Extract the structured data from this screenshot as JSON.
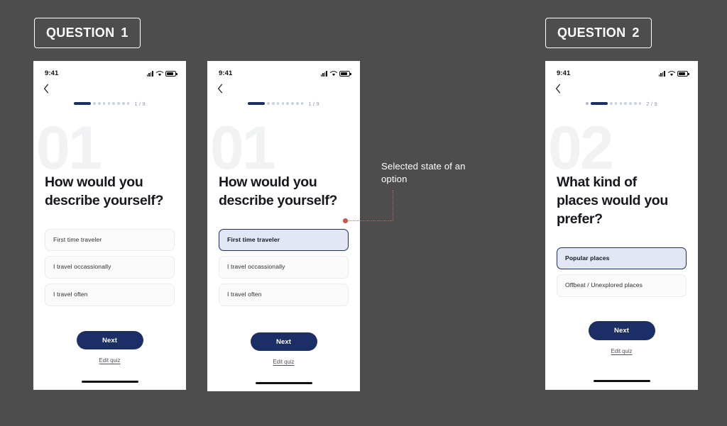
{
  "background_color": "#4d4d4d",
  "accent_color": "#1b2f66",
  "annotation_color": "#c8564a",
  "labels": [
    {
      "id": "q1",
      "text": "QUESTION",
      "number": "1"
    },
    {
      "id": "q2",
      "text": "QUESTION",
      "number": "2"
    }
  ],
  "annotation": {
    "text": "Selected state of an option"
  },
  "status_bar": {
    "time": "9:41",
    "icons": [
      "cellular-signal-icon",
      "wifi-icon",
      "battery-icon"
    ]
  },
  "screens": [
    {
      "id": "screen-1",
      "watermark": "01",
      "progress": {
        "current": 1,
        "total": 9,
        "count_label": "1 / 9",
        "leading_dots": 0,
        "trailing_dots": 8
      },
      "question": "How would you describe yourself?",
      "options": [
        {
          "label": "First time traveler",
          "selected": false
        },
        {
          "label": "I travel occassionally",
          "selected": false
        },
        {
          "label": "I travel often",
          "selected": false
        }
      ],
      "next_label": "Next",
      "edit_label": "Edit quiz"
    },
    {
      "id": "screen-2",
      "watermark": "01",
      "progress": {
        "current": 1,
        "total": 9,
        "count_label": "1 / 9",
        "leading_dots": 0,
        "trailing_dots": 8
      },
      "question": "How would you describe yourself?",
      "options": [
        {
          "label": "First time traveler",
          "selected": true
        },
        {
          "label": "I travel occassionally",
          "selected": false
        },
        {
          "label": "I travel often",
          "selected": false
        }
      ],
      "next_label": "Next",
      "edit_label": "Edit quiz"
    },
    {
      "id": "screen-3",
      "watermark": "02",
      "progress": {
        "current": 2,
        "total": 9,
        "count_label": "2 / 9",
        "leading_dots": 1,
        "trailing_dots": 7
      },
      "question": "What kind of places would you prefer?",
      "options": [
        {
          "label": "Popular places",
          "selected": true
        },
        {
          "label": "Offbeat / Unexplored places",
          "selected": false
        }
      ],
      "next_label": "Next",
      "edit_label": "Edit quiz"
    }
  ]
}
